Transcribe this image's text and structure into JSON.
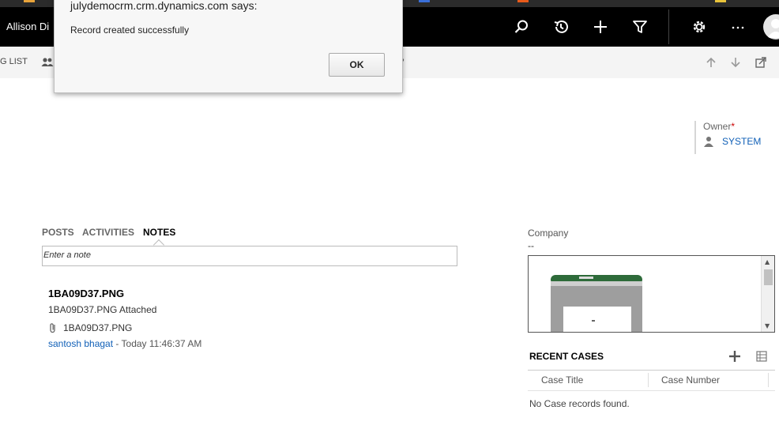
{
  "navbar": {
    "user_name": "Allison Di",
    "icons": [
      "search-icon",
      "history-icon",
      "plus-icon",
      "filter-icon",
      "settings-icon",
      "more-icon",
      "avatar"
    ]
  },
  "commandbar": {
    "partial_label": "G LIST",
    "overflow": "•"
  },
  "owner": {
    "label": "Owner",
    "required_mark": "*",
    "value": "SYSTEM"
  },
  "tabs": [
    {
      "label": "POSTS",
      "active": false
    },
    {
      "label": "ACTIVITIES",
      "active": false
    },
    {
      "label": "NOTES",
      "active": true
    }
  ],
  "notes": {
    "input_placeholder": "Enter a note",
    "items": [
      {
        "title": "1BA09D37.PNG",
        "text": "1BA09D37.PNG Attached",
        "attachment": "1BA09D37.PNG",
        "author": "santosh bhagat",
        "separator": " - ",
        "time": "Today 11:46:37 AM"
      }
    ]
  },
  "company": {
    "label": "Company",
    "value": "--"
  },
  "recent_cases": {
    "title": "RECENT CASES",
    "columns": [
      "Case Title",
      "Case Number"
    ],
    "empty_message": "No Case records found."
  },
  "dialog": {
    "title": "julydemocrm.crm.dynamics.com says:",
    "message": "Record created successfully",
    "ok_label": "OK"
  },
  "colors": {
    "navbar_bg": "#000000",
    "link_blue": "#1160b7",
    "required_red": "#cc0000"
  }
}
